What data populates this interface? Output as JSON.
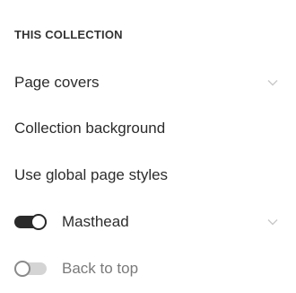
{
  "section": {
    "title": "THIS COLLECTION"
  },
  "items": [
    {
      "label": "Page covers",
      "has_chevron": true,
      "icon": "chevron-down-icon"
    },
    {
      "label": "Collection background",
      "has_chevron": false
    },
    {
      "label": "Use global page styles",
      "has_chevron": false
    },
    {
      "label": "Masthead",
      "toggle": "on",
      "has_chevron": true,
      "icon": "chevron-down-icon"
    },
    {
      "label": "Back to top",
      "toggle": "off",
      "has_chevron": false
    }
  ],
  "colors": {
    "text": "#2c2c2c",
    "toggle_on": "#2a2a2a",
    "toggle_off": "#d4d4d4",
    "chevron": "#c8c8c8",
    "muted_text": "#7a7a7a"
  }
}
